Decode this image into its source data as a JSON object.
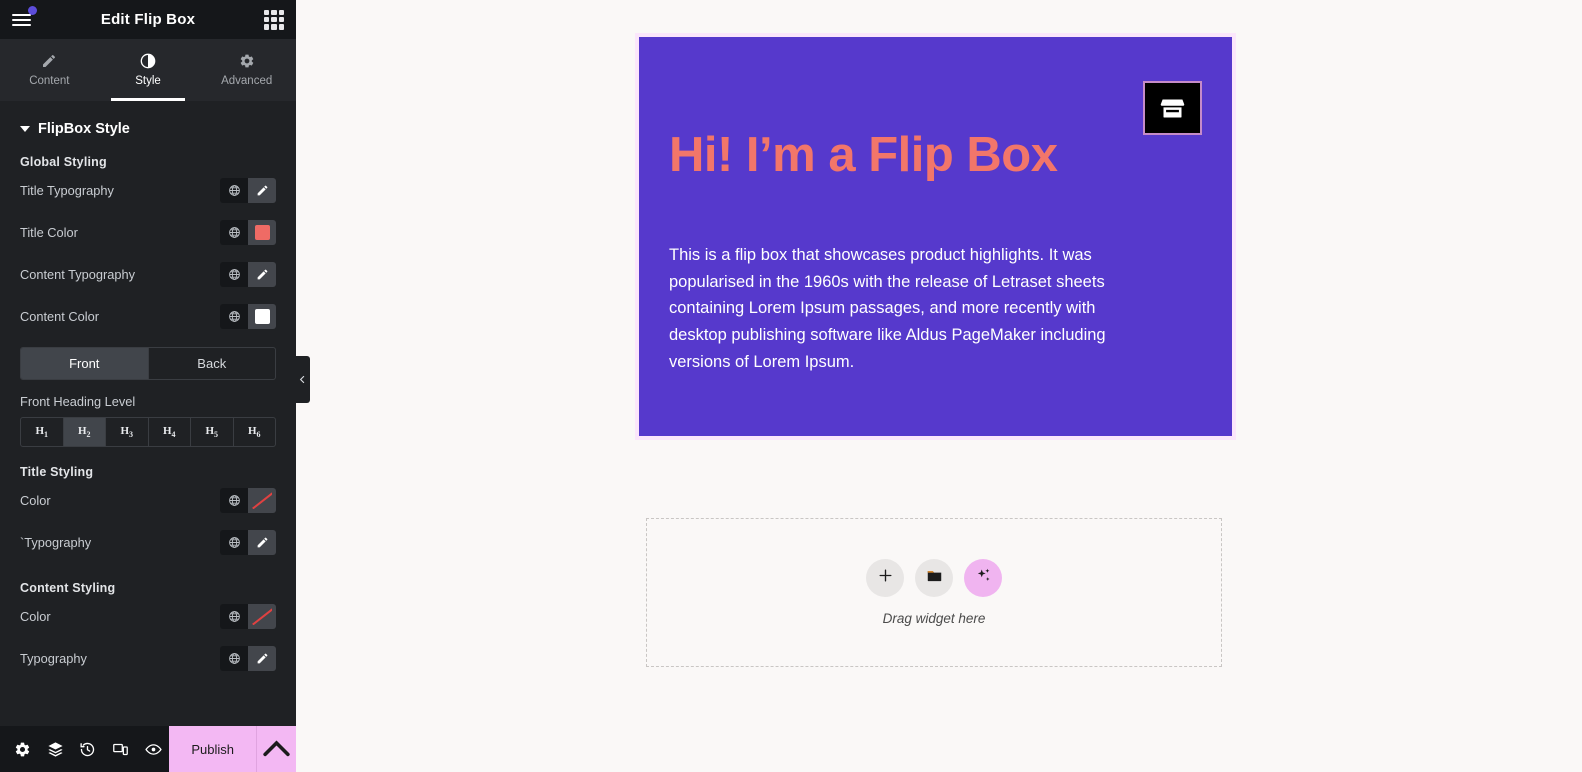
{
  "panel": {
    "title": "Edit Flip Box",
    "menu_icon": "hamburger-icon",
    "widgets_icon": "grid-icon",
    "tabs": [
      {
        "label": "Content",
        "icon": "pencil-icon",
        "active": false
      },
      {
        "label": "Style",
        "icon": "half-circle-icon",
        "active": true
      },
      {
        "label": "Advanced",
        "icon": "gear-icon",
        "active": false
      }
    ],
    "section": {
      "title": "FlipBox Style",
      "expanded": true
    },
    "global_styling": {
      "heading": "Global Styling",
      "controls": [
        {
          "label": "Title Typography",
          "type": "typography",
          "globe": "globe-icon",
          "action": "pencil-icon"
        },
        {
          "label": "Title Color",
          "type": "color",
          "globe": "globe-icon",
          "swatch": "#ef6b65"
        },
        {
          "label": "Content Typography",
          "type": "typography",
          "globe": "globe-icon",
          "action": "pencil-icon"
        },
        {
          "label": "Content Color",
          "type": "color",
          "globe": "globe-icon",
          "swatch": "#ffffff"
        }
      ]
    },
    "side_toggle": {
      "options": [
        "Front",
        "Back"
      ],
      "selected": "Front"
    },
    "heading_level": {
      "label": "Front Heading Level",
      "options": [
        "H1",
        "H2",
        "H3",
        "H4",
        "H5",
        "H6"
      ],
      "selected": "H2"
    },
    "title_styling": {
      "heading": "Title Styling",
      "controls": [
        {
          "label": "Color",
          "type": "color-empty",
          "globe": "globe-icon"
        },
        {
          "label": "`Typography",
          "type": "typography",
          "globe": "globe-icon",
          "action": "pencil-icon"
        }
      ]
    },
    "content_styling": {
      "heading": "Content Styling",
      "controls": [
        {
          "label": "Color",
          "type": "color-empty",
          "globe": "globe-icon"
        },
        {
          "label": "Typography",
          "type": "typography",
          "globe": "globe-icon",
          "action": "pencil-icon"
        }
      ]
    },
    "footer": {
      "icons": [
        "gear-icon",
        "layers-icon",
        "history-icon",
        "responsive-icon",
        "preview-icon"
      ],
      "publish_label": "Publish",
      "publish_arrow": "chevron-up-icon",
      "publish_color": "#f3b8f3"
    },
    "collapse_icon": "chevron-left-icon"
  },
  "canvas": {
    "flipbox": {
      "title": "Hi! I’m a Flip Box",
      "body": "This is a flip box that showcases product highlights. It was popularised in the 1960s with the release of Letraset sheets containing Lorem Ipsum passages, and more recently with desktop publishing software like Aldus PageMaker including versions of Lorem Ipsum.",
      "icon": "storefront-icon",
      "background_color": "#5639cc",
      "title_color": "#f2766a",
      "body_color": "#ffffff",
      "selection_outline_color": "#fbe6fb"
    },
    "dropzone": {
      "label": "Drag widget here",
      "buttons": [
        {
          "icon": "plus-icon",
          "style": "neutral"
        },
        {
          "icon": "folder-icon",
          "style": "neutral"
        },
        {
          "icon": "sparkles-icon",
          "style": "ai"
        }
      ]
    }
  }
}
